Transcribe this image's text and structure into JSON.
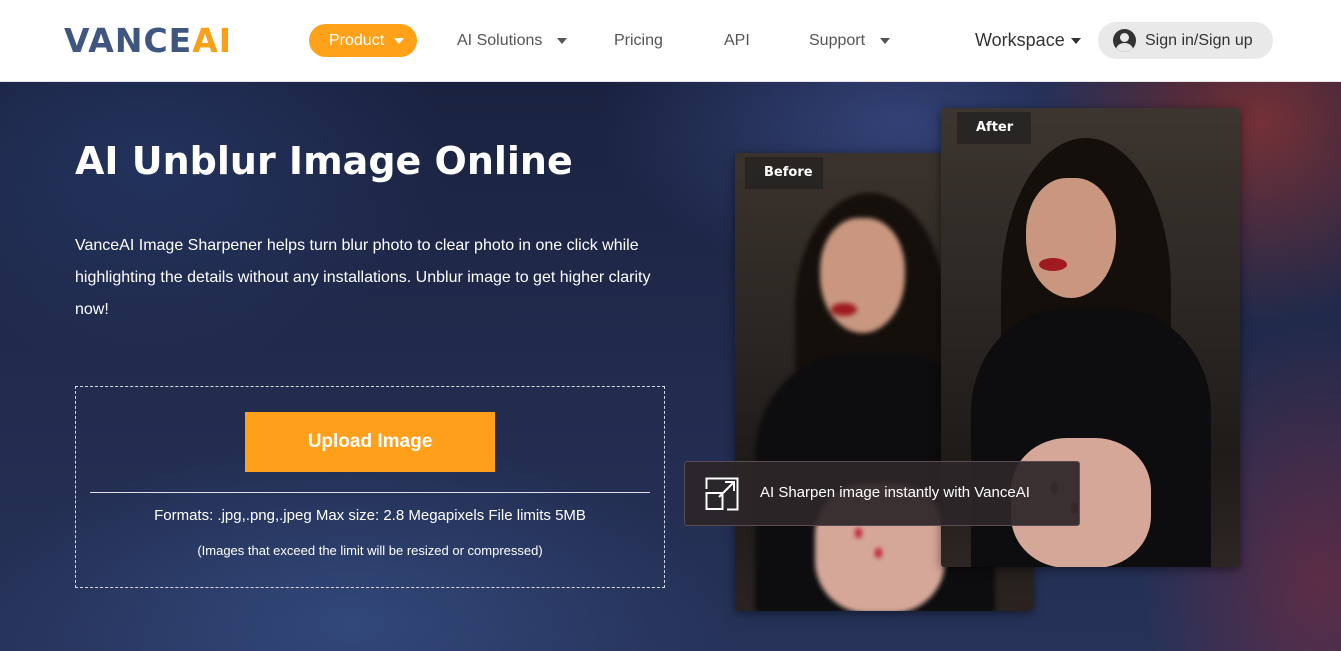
{
  "header": {
    "logo_part1": "VANCE",
    "logo_part2": "AI",
    "nav": {
      "product": "Product",
      "ai_solutions": "AI Solutions",
      "pricing": "Pricing",
      "api": "API",
      "support": "Support"
    },
    "workspace": "Workspace",
    "signin": "Sign in/Sign up"
  },
  "hero": {
    "title": "AI Unblur Image Online",
    "description": "VanceAI Image Sharpener helps turn blur photo to clear photo in one click while highlighting the details without any installations. Unblur image to get higher clarity now!",
    "upload_label": "Upload Image",
    "formats": "Formats: .jpg,.png,.jpeg Max size: 2.8 Megapixels File limits 5MB",
    "note": "(Images that exceed the limit will be resized or compressed)"
  },
  "comparison": {
    "before_label": "Before",
    "after_label": "After",
    "caption": "AI Sharpen image instantly with VanceAI"
  },
  "colors": {
    "brand_blue": "#3e5680",
    "accent_orange": "#ffa21a"
  }
}
